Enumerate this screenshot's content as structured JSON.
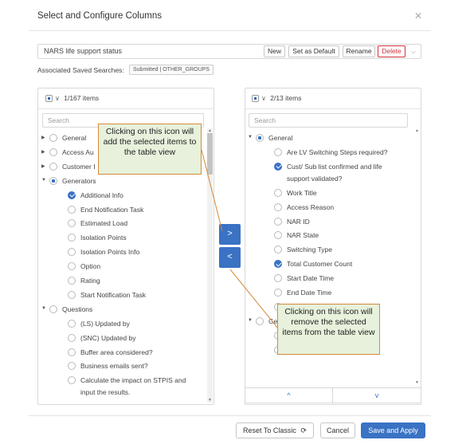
{
  "dialog": {
    "title": "Select and Configure Columns",
    "close_icon": "close-icon"
  },
  "saved_search": {
    "name": "NARS life support status",
    "buttons": {
      "new": "New",
      "set_default": "Set as Default",
      "rename": "Rename",
      "delete": "Delete"
    },
    "associated_label": "Associated Saved Searches:",
    "associated_badge": "Submitted | OTHER_GROUPS"
  },
  "left_panel": {
    "count": "1/167 items",
    "search_placeholder": "Search",
    "rows": [
      {
        "label": "General",
        "level": 0,
        "expand": "right",
        "state": "unchecked"
      },
      {
        "label": "Access Au",
        "level": 0,
        "expand": "right",
        "state": "unchecked"
      },
      {
        "label": "Customer I",
        "level": 0,
        "expand": "right",
        "state": "unchecked"
      },
      {
        "label": "Generators",
        "level": 0,
        "expand": "down",
        "state": "partial"
      },
      {
        "label": "Additional Info",
        "level": 1,
        "state": "checked"
      },
      {
        "label": "End Notification Task",
        "level": 1,
        "state": "unchecked"
      },
      {
        "label": "Estimated Load",
        "level": 1,
        "state": "unchecked"
      },
      {
        "label": "Isolation Points",
        "level": 1,
        "state": "unchecked"
      },
      {
        "label": "Isolation Points Info",
        "level": 1,
        "state": "unchecked"
      },
      {
        "label": "Option",
        "level": 1,
        "state": "unchecked"
      },
      {
        "label": "Rating",
        "level": 1,
        "state": "unchecked"
      },
      {
        "label": "Start Notification Task",
        "level": 1,
        "state": "unchecked"
      },
      {
        "label": "Questions",
        "level": 0,
        "expand": "down",
        "state": "unchecked"
      },
      {
        "label": "(LS) Updated by",
        "level": 1,
        "state": "unchecked"
      },
      {
        "label": "(SNC) Updated by",
        "level": 1,
        "state": "unchecked"
      },
      {
        "label": "Buffer area considered?",
        "level": 1,
        "state": "unchecked"
      },
      {
        "label": "Business emails sent?",
        "level": 1,
        "state": "unchecked"
      },
      {
        "label": "Calculate the impact on STPIS and",
        "level": 1,
        "state": "unchecked"
      },
      {
        "label": "input the results.",
        "level": 1,
        "state": "none"
      }
    ]
  },
  "right_panel": {
    "count": "2/13 items",
    "search_placeholder": "Search",
    "rows": [
      {
        "label": "General",
        "level": 0,
        "expand": "down",
        "state": "partial"
      },
      {
        "label": "Are LV Switching Steps required?",
        "level": 1,
        "state": "unchecked"
      },
      {
        "label": "Cust/ Sub list confirmed and life",
        "level": 1,
        "state": "checked"
      },
      {
        "label": "support validated?",
        "level": 1,
        "state": "none"
      },
      {
        "label": "Work Title",
        "level": 1,
        "state": "unchecked"
      },
      {
        "label": "Access Reason",
        "level": 1,
        "state": "unchecked"
      },
      {
        "label": "NAR ID",
        "level": 1,
        "state": "unchecked"
      },
      {
        "label": "NAR State",
        "level": 1,
        "state": "unchecked"
      },
      {
        "label": "Switching Type",
        "level": 1,
        "state": "unchecked"
      },
      {
        "label": "Total Customer Count",
        "level": 1,
        "state": "checked"
      },
      {
        "label": "Start Date Time",
        "level": 1,
        "state": "unchecked"
      },
      {
        "label": "End Date Time",
        "level": 1,
        "state": "unchecked"
      },
      {
        "label": "",
        "level": 1,
        "state": "unchecked"
      },
      {
        "label": "Ge",
        "level": 0,
        "expand": "down",
        "state": "unchecked"
      },
      {
        "label": "",
        "level": 1,
        "state": "unchecked"
      },
      {
        "label": "",
        "level": 1,
        "state": "unchecked"
      }
    ]
  },
  "move": {
    "add_glyph": ">",
    "remove_glyph": "<"
  },
  "sort": {
    "up_glyph": "^",
    "down_glyph": "v"
  },
  "callouts": {
    "add": "Clicking on this icon will add the selected items to the table view",
    "remove": "Clicking on this icon will remove the selected items from the table view"
  },
  "footer": {
    "reset": "Reset To Classic",
    "cancel": "Cancel",
    "save": "Save and Apply"
  },
  "colors": {
    "accent": "#3a72c4",
    "danger": "#d0313d",
    "callout_fill": "#e7f1dc",
    "callout_border": "#d48b3a"
  }
}
